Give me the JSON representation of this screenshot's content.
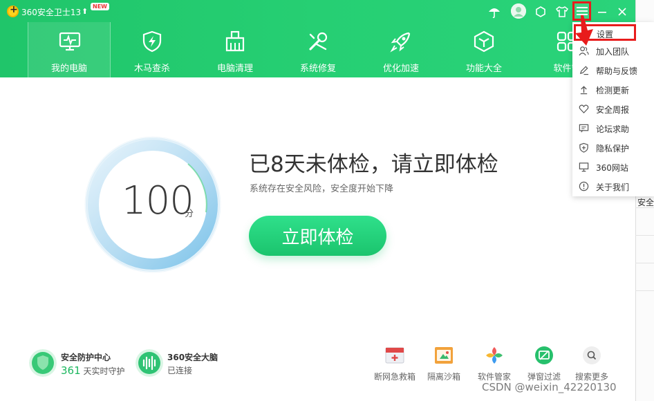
{
  "app": {
    "title": "360安全卫士13",
    "new_badge": "NEW"
  },
  "nav": {
    "items": [
      {
        "label": "我的电脑",
        "icon": "monitor-icon"
      },
      {
        "label": "木马查杀",
        "icon": "shield-bolt-icon"
      },
      {
        "label": "电脑清理",
        "icon": "broom-icon"
      },
      {
        "label": "系统修复",
        "icon": "wrench-icon"
      },
      {
        "label": "优化加速",
        "icon": "rocket-icon"
      },
      {
        "label": "功能大全",
        "icon": "cube-icon"
      },
      {
        "label": "软件管",
        "icon": "apps-icon"
      }
    ]
  },
  "score": {
    "value": "100",
    "unit": "分"
  },
  "status": {
    "headline": "已8天未体检，请立即体检",
    "subline": "系统存在安全风险，安全度开始下降",
    "scan_label": "立即体检"
  },
  "footer": {
    "protect_title": "安全防护中心",
    "protect_count": "361",
    "protect_suffix": "天实时守护",
    "brain_title": "360安全大脑",
    "brain_sub": "已连接",
    "tools": [
      {
        "label": "断网急救箱",
        "icon": "first-aid-icon"
      },
      {
        "label": "隔离沙箱",
        "icon": "sandbox-icon"
      },
      {
        "label": "软件管家",
        "icon": "software-manager-icon"
      },
      {
        "label": "弹窗过滤",
        "icon": "popup-filter-icon"
      },
      {
        "label": "搜索更多",
        "icon": "search-icon"
      }
    ]
  },
  "menu": {
    "items": [
      {
        "label": "设置",
        "icon": "gear-icon"
      },
      {
        "label": "加入团队",
        "icon": "users-icon"
      },
      {
        "label": "帮助与反馈",
        "icon": "pencil-icon"
      },
      {
        "label": "检测更新",
        "icon": "upload-icon"
      },
      {
        "label": "安全周报",
        "icon": "heart-icon"
      },
      {
        "label": "论坛求助",
        "icon": "chat-icon"
      },
      {
        "label": "隐私保护",
        "icon": "privacy-shield-icon"
      },
      {
        "label": "360网站",
        "icon": "monitor-small-icon"
      },
      {
        "label": "关于我们",
        "icon": "info-icon"
      }
    ]
  },
  "behind_window": {
    "text": "安全"
  },
  "watermark": "CSDN @weixin_42220130",
  "colors": {
    "brand_green": "#26cf73",
    "highlight_red": "#e81c1c"
  }
}
